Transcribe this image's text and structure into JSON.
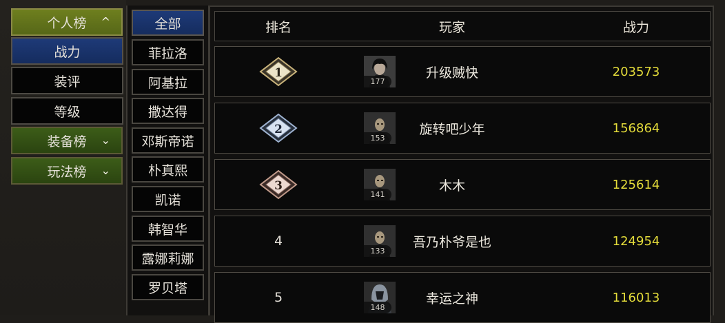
{
  "left_menu": {
    "personal": {
      "label": "个人榜",
      "chevron": "^"
    },
    "personal_items": [
      "战力",
      "装评",
      "等级"
    ],
    "equipment": {
      "label": "装备榜",
      "chevron": "⌄"
    },
    "gameplay": {
      "label": "玩法榜",
      "chevron": "⌄"
    }
  },
  "characters": [
    "全部",
    "菲拉洛",
    "阿基拉",
    "撒达得",
    "邓斯帝诺",
    "朴真熙",
    "凯诺",
    "韩智华",
    "露娜莉娜",
    "罗贝塔"
  ],
  "table": {
    "headers": {
      "rank": "排名",
      "player": "玩家",
      "power": "战力"
    },
    "rows": [
      {
        "rank": "1",
        "level": "177",
        "name": "升级贼快",
        "power": "203573",
        "avatar": "dark-hair-portrait"
      },
      {
        "rank": "2",
        "level": "153",
        "name": "旋转吧少年",
        "power": "156864",
        "avatar": "bald-portrait"
      },
      {
        "rank": "3",
        "level": "141",
        "name": "木木",
        "power": "125614",
        "avatar": "bald-portrait"
      },
      {
        "rank": "4",
        "level": "133",
        "name": "吾乃朴爷是也",
        "power": "124954",
        "avatar": "bald-portrait"
      },
      {
        "rank": "5",
        "level": "148",
        "name": "幸运之神",
        "power": "116013",
        "avatar": "helmet-portrait"
      }
    ]
  },
  "colors": {
    "power_text": "#e4dc3a",
    "selected_blue": "#1e3a78",
    "category_green": "#3c5c18",
    "open_category_olive": "#6e7f1e",
    "medal_gold": "#c8b27a",
    "medal_silver": "#9fb3d1",
    "medal_bronze": "#c09a8a"
  }
}
